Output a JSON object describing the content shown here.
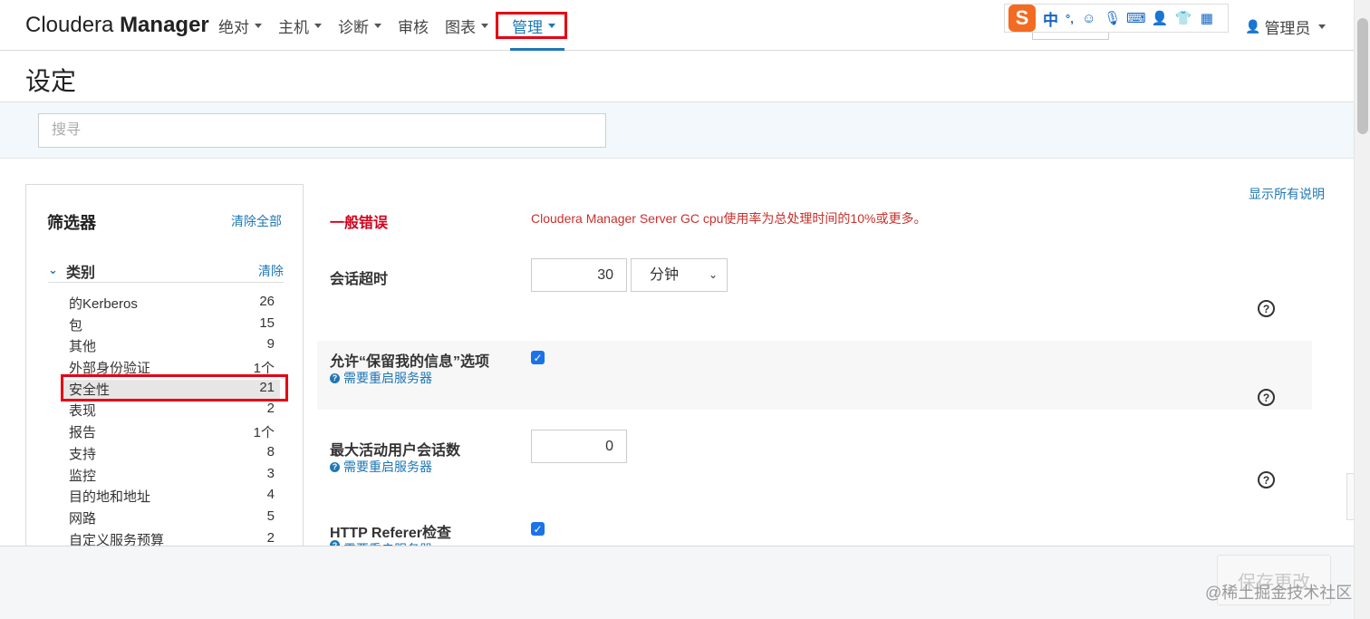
{
  "brand": {
    "part1": "Cloudera ",
    "part2": "Manager"
  },
  "nav": [
    {
      "label": "绝对",
      "caret": true
    },
    {
      "label": "主机",
      "caret": true
    },
    {
      "label": "诊断",
      "caret": true
    },
    {
      "label": "审核",
      "caret": false
    },
    {
      "label": "图表",
      "caret": true
    },
    {
      "label": "管理",
      "caret": true,
      "active": true
    }
  ],
  "ime": {
    "lang": "中",
    "punct": "°,"
  },
  "user": {
    "label": "管理员"
  },
  "page_title": "设定",
  "search": {
    "placeholder": "搜寻"
  },
  "filter": {
    "title": "筛选器",
    "clear_all": "清除全部",
    "category_label": "类别",
    "category_clear": "清除",
    "categories": [
      {
        "name": "的Kerberos",
        "count": "26"
      },
      {
        "name": "包",
        "count": "15"
      },
      {
        "name": "其他",
        "count": "9"
      },
      {
        "name": "外部身份验证",
        "count": "1个"
      },
      {
        "name": "安全性",
        "count": "21",
        "selected": true
      },
      {
        "name": "表现",
        "count": "2"
      },
      {
        "name": "报告",
        "count": "1个"
      },
      {
        "name": "支持",
        "count": "8"
      },
      {
        "name": "监控",
        "count": "3"
      },
      {
        "name": "目的地和地址",
        "count": "4"
      },
      {
        "name": "网路",
        "count": "5"
      },
      {
        "name": "自定义服务预算",
        "count": "2"
      }
    ]
  },
  "show_all_desc": "显示所有说明",
  "settings": {
    "general_error_label": "一般错误",
    "general_error_msg": "Cloudera Manager Server GC cpu使用率为总处理时间的10%或更多。",
    "session_timeout_label": "会话超时",
    "session_timeout_value": "30",
    "session_timeout_unit": "分钟",
    "remember_me_label": "允许“保留我的信息”选项",
    "max_sessions_label": "最大活动用户会话数",
    "max_sessions_value": "0",
    "referer_label": "HTTP Referer检查",
    "restart_required": "需要重启服务器"
  },
  "save_button": "保存更改",
  "watermark": "@稀土掘金技术社区",
  "colors": {
    "accent": "#1f77b4",
    "highlight_box": "#e60012",
    "error": "#c9302c"
  }
}
